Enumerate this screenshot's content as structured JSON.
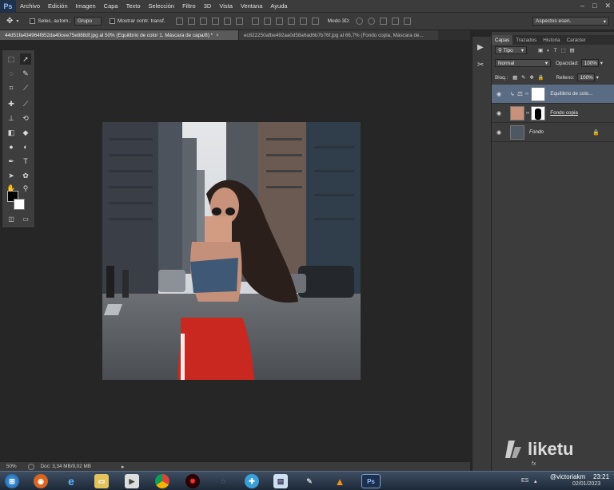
{
  "app": {
    "logo": "Ps"
  },
  "menu": [
    "Archivo",
    "Edición",
    "Imagen",
    "Capa",
    "Texto",
    "Selección",
    "Filtro",
    "3D",
    "Vista",
    "Ventana",
    "Ayuda"
  ],
  "options": {
    "auto_select_label": "Selec. autom.:",
    "auto_select_value": "Grupo",
    "show_transform_label": "Mostrar contr. transf.",
    "mode_3d_label": "Modo 3D:",
    "workspace": "Aspectos esen."
  },
  "tabs": [
    {
      "title": "44d51fa434964f852da40cee75e888df.jpg al 50% (Equilibrio de color 1, Máscara de capa/8) *"
    },
    {
      "title": "ec822250afbe492aa0d58a6ad6b7b76f.jpg al 66,7% (Fondo copia, Máscara de..."
    }
  ],
  "status": {
    "zoom": "50%",
    "doc": "Doc: 3,34 MB/9,02 MB"
  },
  "panel": {
    "tabs": [
      "Capas",
      "Trazados",
      "Historia",
      "Carácter"
    ],
    "filter": "Tipo",
    "blend_mode": "Normal",
    "opacity_label": "Opacidad:",
    "opacity": "100%",
    "lock_label": "Bloq.:",
    "fill_label": "Relleno:",
    "fill": "100%",
    "layers": [
      {
        "name": "Equilibrio de colo...",
        "selected": true
      },
      {
        "name": "Fondo copia",
        "selected": false
      },
      {
        "name": "Fondo",
        "selected": false
      }
    ]
  },
  "taskbar": {
    "language": "ES",
    "date": "02/01/2023",
    "time": "23:21",
    "username": "@victoriakm"
  },
  "watermark": "liketu"
}
